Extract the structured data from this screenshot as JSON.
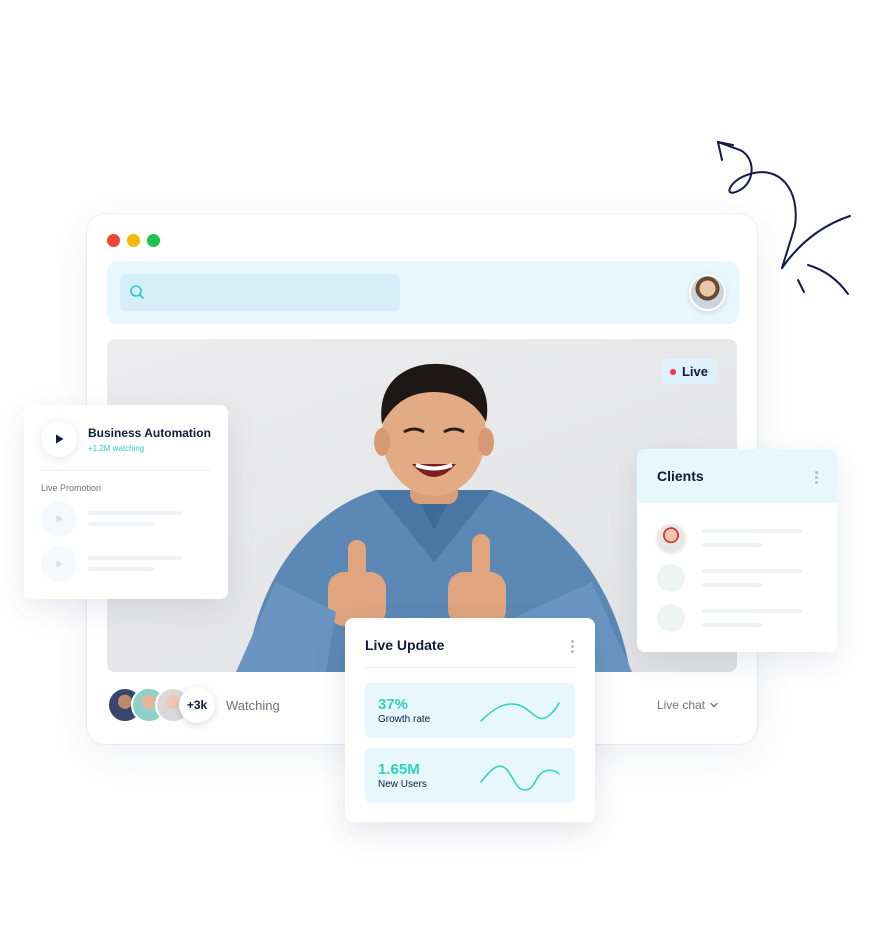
{
  "window": {
    "controls": [
      "close",
      "minimize",
      "maximize"
    ]
  },
  "search": {
    "placeholder": "",
    "icon": "search-icon"
  },
  "video": {
    "live_label": "Live"
  },
  "viewers": {
    "count_label": "+3k",
    "watching_label": "Watching"
  },
  "chat": {
    "label": "Live chat"
  },
  "left_card": {
    "title": "Business Automation",
    "subtitle": "+1.2M watching",
    "section_label": "Live Promotion"
  },
  "clients_card": {
    "title": "Clients"
  },
  "live_update": {
    "title": "Live Update",
    "stats": [
      {
        "value": "37%",
        "label": "Growth rate"
      },
      {
        "value": "1.65M",
        "label": "New Users"
      }
    ]
  },
  "colors": {
    "accent": "#2ad4c3",
    "navy": "#0f1b3d",
    "panel": "#e8f6fd",
    "live_dot": "#ff2d55"
  }
}
